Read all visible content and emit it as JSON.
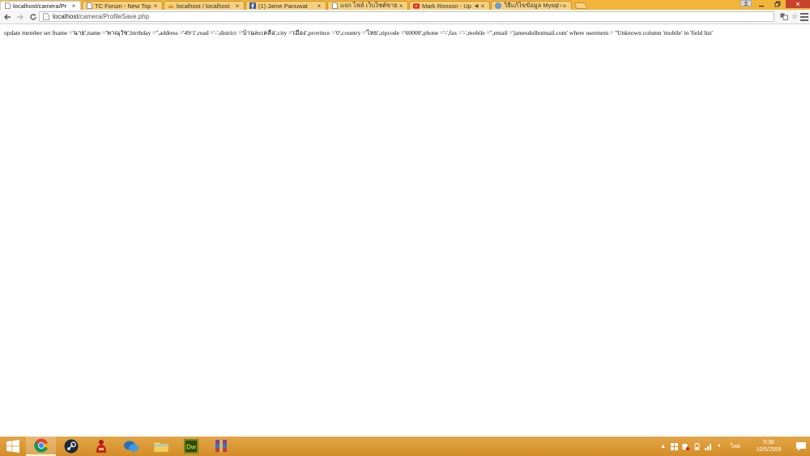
{
  "browser": {
    "tabs": [
      {
        "title": "localhost/camera/Pr",
        "icon": "page-icon",
        "active": true
      },
      {
        "title": "TC Forum - New Top",
        "icon": "page-icon",
        "active": false
      },
      {
        "title": "localhost / localhost",
        "icon": "phpmyadmin-icon",
        "active": false
      },
      {
        "title": "(1) Jame Panuwat",
        "icon": "facebook-icon",
        "active": false
      },
      {
        "title": "แจก ไฟล์ เว็บไซต์ขายมือ",
        "icon": "page-icon",
        "active": false
      },
      {
        "title": "Mark Ronson - Up",
        "icon": "youtube-icon",
        "active": false
      },
      {
        "title": "วิธีแก้ไขข้อมูล Mysql d",
        "icon": "page-icon",
        "active": false
      }
    ],
    "address": {
      "host": "localhost",
      "path": "/camera/ProfileSave.php"
    }
  },
  "page": {
    "output_text": "update member set fname ='นาย',name ='พาณุวัช',birthday ='',address ='49/1',road ='-',district ='บ้านละเคลือ',city ='เมือง',province ='0',country ='ไทย',zipcode ='60000',phone ='-',fax ='-',mobile ='',email ='jamesdolhotmail.com' where usermem = ''Unknown column 'mobile' in 'field list'"
  },
  "taskbar": {
    "apps": [
      {
        "name": "chrome",
        "active": true
      },
      {
        "name": "steam",
        "active": false
      },
      {
        "name": "app-red-figure",
        "active": false
      },
      {
        "name": "chat",
        "active": false
      },
      {
        "name": "file-explorer",
        "active": false
      },
      {
        "name": "dreamweaver",
        "active": false,
        "label": "Dw"
      },
      {
        "name": "winrar",
        "active": false
      }
    ],
    "language": "ไทย",
    "time": "0:38",
    "date": "10/5/2559"
  },
  "colors": {
    "tabstrip": "#f2b53a",
    "taskbar": "#d38e2a",
    "facebook": "#3b5998",
    "youtube": "#e52d27"
  }
}
